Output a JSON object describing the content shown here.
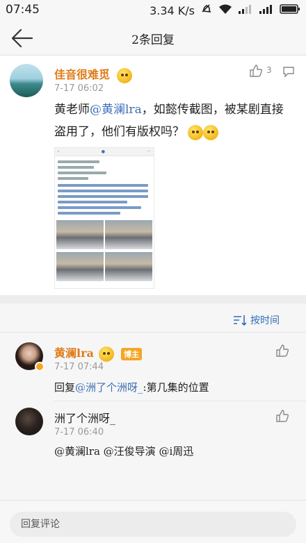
{
  "status_bar": {
    "time": "07:45",
    "speed": "3.34 K/s"
  },
  "nav": {
    "title": "2条回复"
  },
  "post": {
    "username": "佳音很难觅",
    "time": "7-17 06:02",
    "like_count": "3",
    "text_prefix": "黄老师",
    "mention": "@黄澜lra",
    "text_suffix": "，如懿传截图，被某剧直接盗用了，他们有版权吗？"
  },
  "comments_section": {
    "sort_label": "按时间",
    "comments": [
      {
        "username": "黄澜lra",
        "badge": "博主",
        "time": "7-17 07:44",
        "reply_prefix": "回复",
        "reply_mention": "@洲了个洲呀_",
        "reply_text": ":第几集的位置"
      },
      {
        "username": "洲了个洲呀_",
        "time": "7-17 06:40",
        "mentions": "@黄澜lra @汪俊导演 @i周迅"
      }
    ]
  },
  "bottom": {
    "placeholder": "回复评论"
  },
  "colors": {
    "username": "#e07b18",
    "mention": "#3b6fb6",
    "badge": "#f5a623"
  }
}
